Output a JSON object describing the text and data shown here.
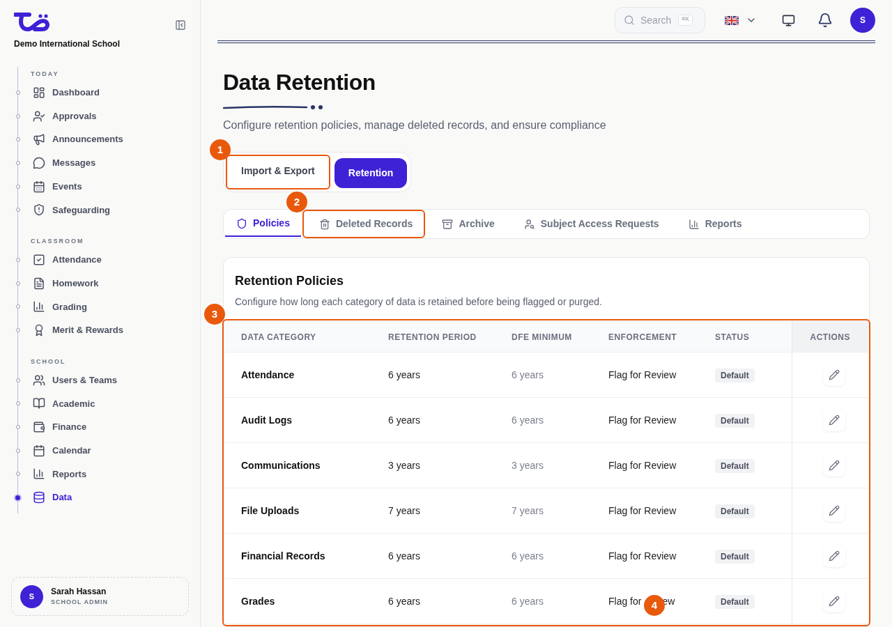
{
  "sidebar": {
    "school_name": "Demo International School",
    "sections": [
      {
        "heading": "TODAY",
        "items": [
          {
            "label": "Dashboard",
            "selected": false
          },
          {
            "label": "Approvals",
            "selected": false
          },
          {
            "label": "Announcements",
            "selected": false
          },
          {
            "label": "Messages",
            "selected": false
          },
          {
            "label": "Events",
            "selected": false
          },
          {
            "label": "Safeguarding",
            "selected": false
          }
        ]
      },
      {
        "heading": "CLASSROOM",
        "items": [
          {
            "label": "Attendance",
            "selected": false
          },
          {
            "label": "Homework",
            "selected": false
          },
          {
            "label": "Grading",
            "selected": false
          },
          {
            "label": "Merit & Rewards",
            "selected": false
          }
        ]
      },
      {
        "heading": "SCHOOL",
        "items": [
          {
            "label": "Users & Teams",
            "selected": false
          },
          {
            "label": "Academic",
            "selected": false
          },
          {
            "label": "Finance",
            "selected": false
          },
          {
            "label": "Calendar",
            "selected": false
          },
          {
            "label": "Reports",
            "selected": false
          },
          {
            "label": "Data",
            "selected": true
          }
        ]
      }
    ],
    "user": {
      "initial": "S",
      "name": "Sarah Hassan",
      "role": "SCHOOL ADMIN"
    }
  },
  "header": {
    "search": {
      "placeholder": "Search",
      "shortcut": "⌘K"
    },
    "avatar": "S"
  },
  "page": {
    "title": "Data Retention",
    "subtitle": "Configure retention policies, manage deleted records, and ensure compliance"
  },
  "segments": [
    {
      "label": "Import & Export",
      "selected": false,
      "annotation": "1"
    },
    {
      "label": "Retention",
      "selected": true
    }
  ],
  "tabs": [
    {
      "label": "Policies",
      "selected": true
    },
    {
      "label": "Deleted Records",
      "selected": false,
      "annotation": "2"
    },
    {
      "label": "Archive",
      "selected": false
    },
    {
      "label": "Subject Access Requests",
      "selected": false
    },
    {
      "label": "Reports",
      "selected": false
    }
  ],
  "card": {
    "title": "Retention Policies",
    "description": "Configure how long each category of data is retained before being flagged or purged."
  },
  "table": {
    "annotation": "3",
    "columns": [
      "DATA CATEGORY",
      "RETENTION PERIOD",
      "DFE MINIMUM",
      "ENFORCEMENT",
      "STATUS",
      "ACTIONS"
    ],
    "rows": [
      {
        "category": "Attendance",
        "period": "6 years",
        "minimum": "6 years",
        "enforcement": "Flag for Review",
        "status": "Default"
      },
      {
        "category": "Audit Logs",
        "period": "6 years",
        "minimum": "6 years",
        "enforcement": "Flag for Review",
        "status": "Default"
      },
      {
        "category": "Communications",
        "period": "3 years",
        "minimum": "3 years",
        "enforcement": "Flag for Review",
        "status": "Default"
      },
      {
        "category": "File Uploads",
        "period": "7 years",
        "minimum": "7 years",
        "enforcement": "Flag for Review",
        "status": "Default"
      },
      {
        "category": "Financial Records",
        "period": "6 years",
        "minimum": "6 years",
        "enforcement": "Flag for Review",
        "status": "Default"
      },
      {
        "category": "Grades",
        "period": "6 years",
        "minimum": "6 years",
        "enforcement": "Flag for",
        "enforcement_tail": "ew",
        "status": "Default",
        "annotation": "4"
      }
    ]
  }
}
